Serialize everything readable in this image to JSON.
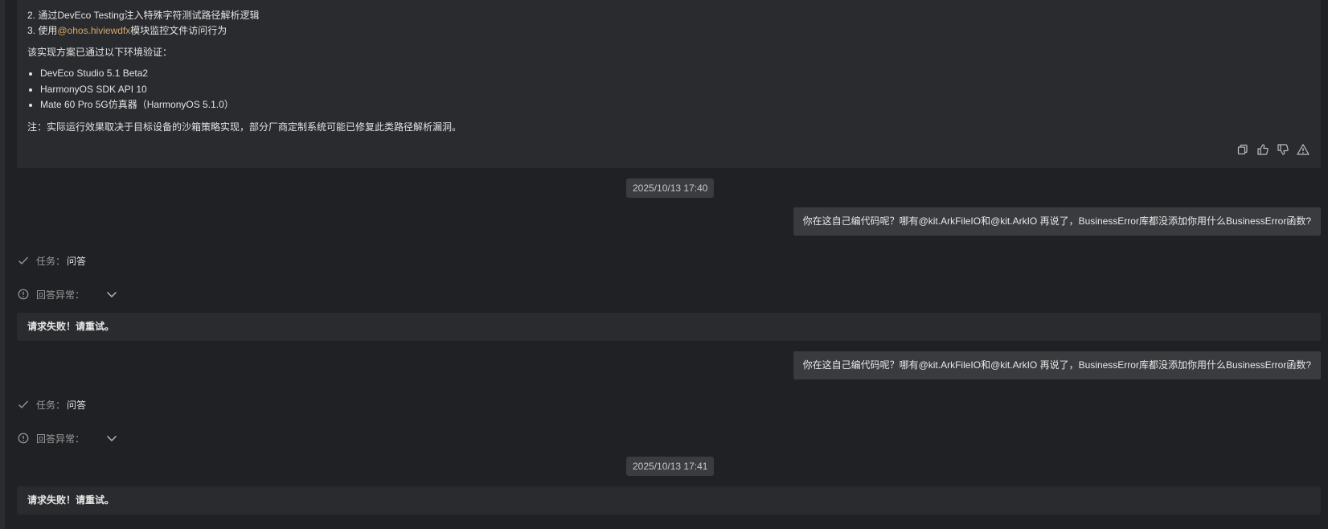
{
  "answer": {
    "step2": "2. 通过DevEco Testing注入特殊字符测试路径解析逻辑",
    "step3_prefix": "3. 使用",
    "step3_code": "@ohos.hiviewdfx",
    "step3_suffix": "模块监控文件访问行为",
    "verified_intro": "该实现方案已通过以下环境验证：",
    "env_items": [
      "DevEco Studio 5.1 Beta2",
      "HarmonyOS SDK API 10",
      "Mate 60 Pro 5G仿真器（HarmonyOS 5.1.0）"
    ],
    "note": "注：实际运行效果取决于目标设备的沙箱策略实现，部分厂商定制系统可能已修复此类路径解析漏洞。",
    "toolbar_icons": [
      "copy-icon",
      "thumbs-up-icon",
      "thumbs-down-icon",
      "warning-icon"
    ]
  },
  "timestamps": [
    "2025/10/13 17:40",
    "2025/10/13 17:41"
  ],
  "messages": [
    {
      "user_text": "你在这自己编代码呢？哪有@kit.ArkFileIO和@kit.ArkIO 再说了，BusinessError库都没添加你用什么BusinessError函数?",
      "task_label": "任务：",
      "task_value": "问答",
      "error_label": "回答异常：",
      "error_text": "请求失败！请重试。"
    },
    {
      "user_text": "你在这自己编代码呢？哪有@kit.ArkFileIO和@kit.ArkIO 再说了，BusinessError库都没添加你用什么BusinessError函数?",
      "task_label": "任务：",
      "task_value": "问答",
      "error_label": "回答异常：",
      "error_text": "请求失败！请重试。"
    }
  ],
  "colors": {
    "background": "#202124",
    "card": "#2a2b2e",
    "bubble": "#3a3b3e",
    "code_accent": "#d8a66a"
  }
}
